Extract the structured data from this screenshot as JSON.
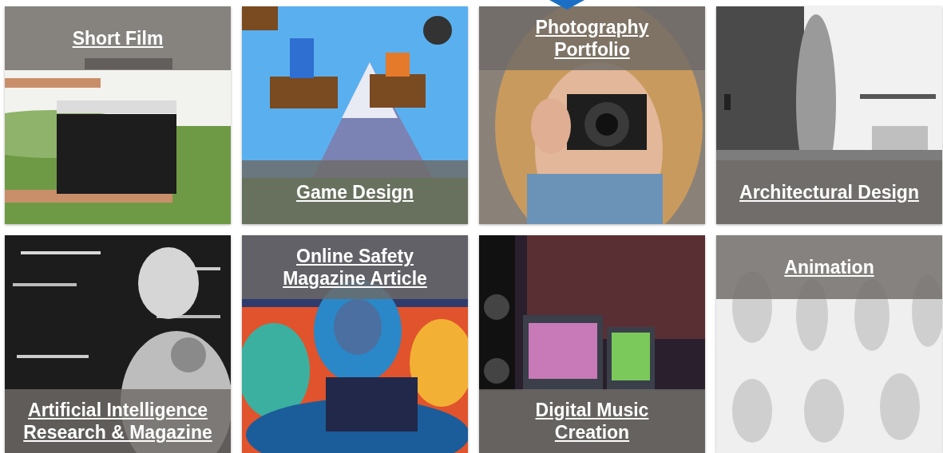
{
  "tiles": [
    {
      "title_lines": [
        "Short Film"
      ],
      "band_on_top": true,
      "picture": {
        "kind": "picture"
      }
    },
    {
      "title_lines": [
        "Game Design"
      ],
      "band_on_top": false,
      "picture": {
        "kind": "picture"
      }
    },
    {
      "title_lines": [
        "Photography",
        "Portfolio"
      ],
      "band_on_top": true,
      "picture": {
        "kind": "picture"
      }
    },
    {
      "title_lines": [
        "Architectural Design"
      ],
      "band_on_top": false,
      "picture": {
        "kind": "picture"
      }
    },
    {
      "title_lines": [
        "Artificial Intelligence",
        "Research & Magazine"
      ],
      "band_on_top": false,
      "picture": {
        "kind": "picture"
      }
    },
    {
      "title_lines": [
        "Online Safety",
        "Magazine Article"
      ],
      "band_on_top": true,
      "picture": {
        "kind": "picture"
      }
    },
    {
      "title_lines": [
        "Digital Music",
        "Creation"
      ],
      "band_on_top": false,
      "picture": {
        "kind": "picture"
      }
    },
    {
      "title_lines": [
        "Animation"
      ],
      "band_on_top": true,
      "picture": {
        "kind": "picture"
      }
    }
  ]
}
